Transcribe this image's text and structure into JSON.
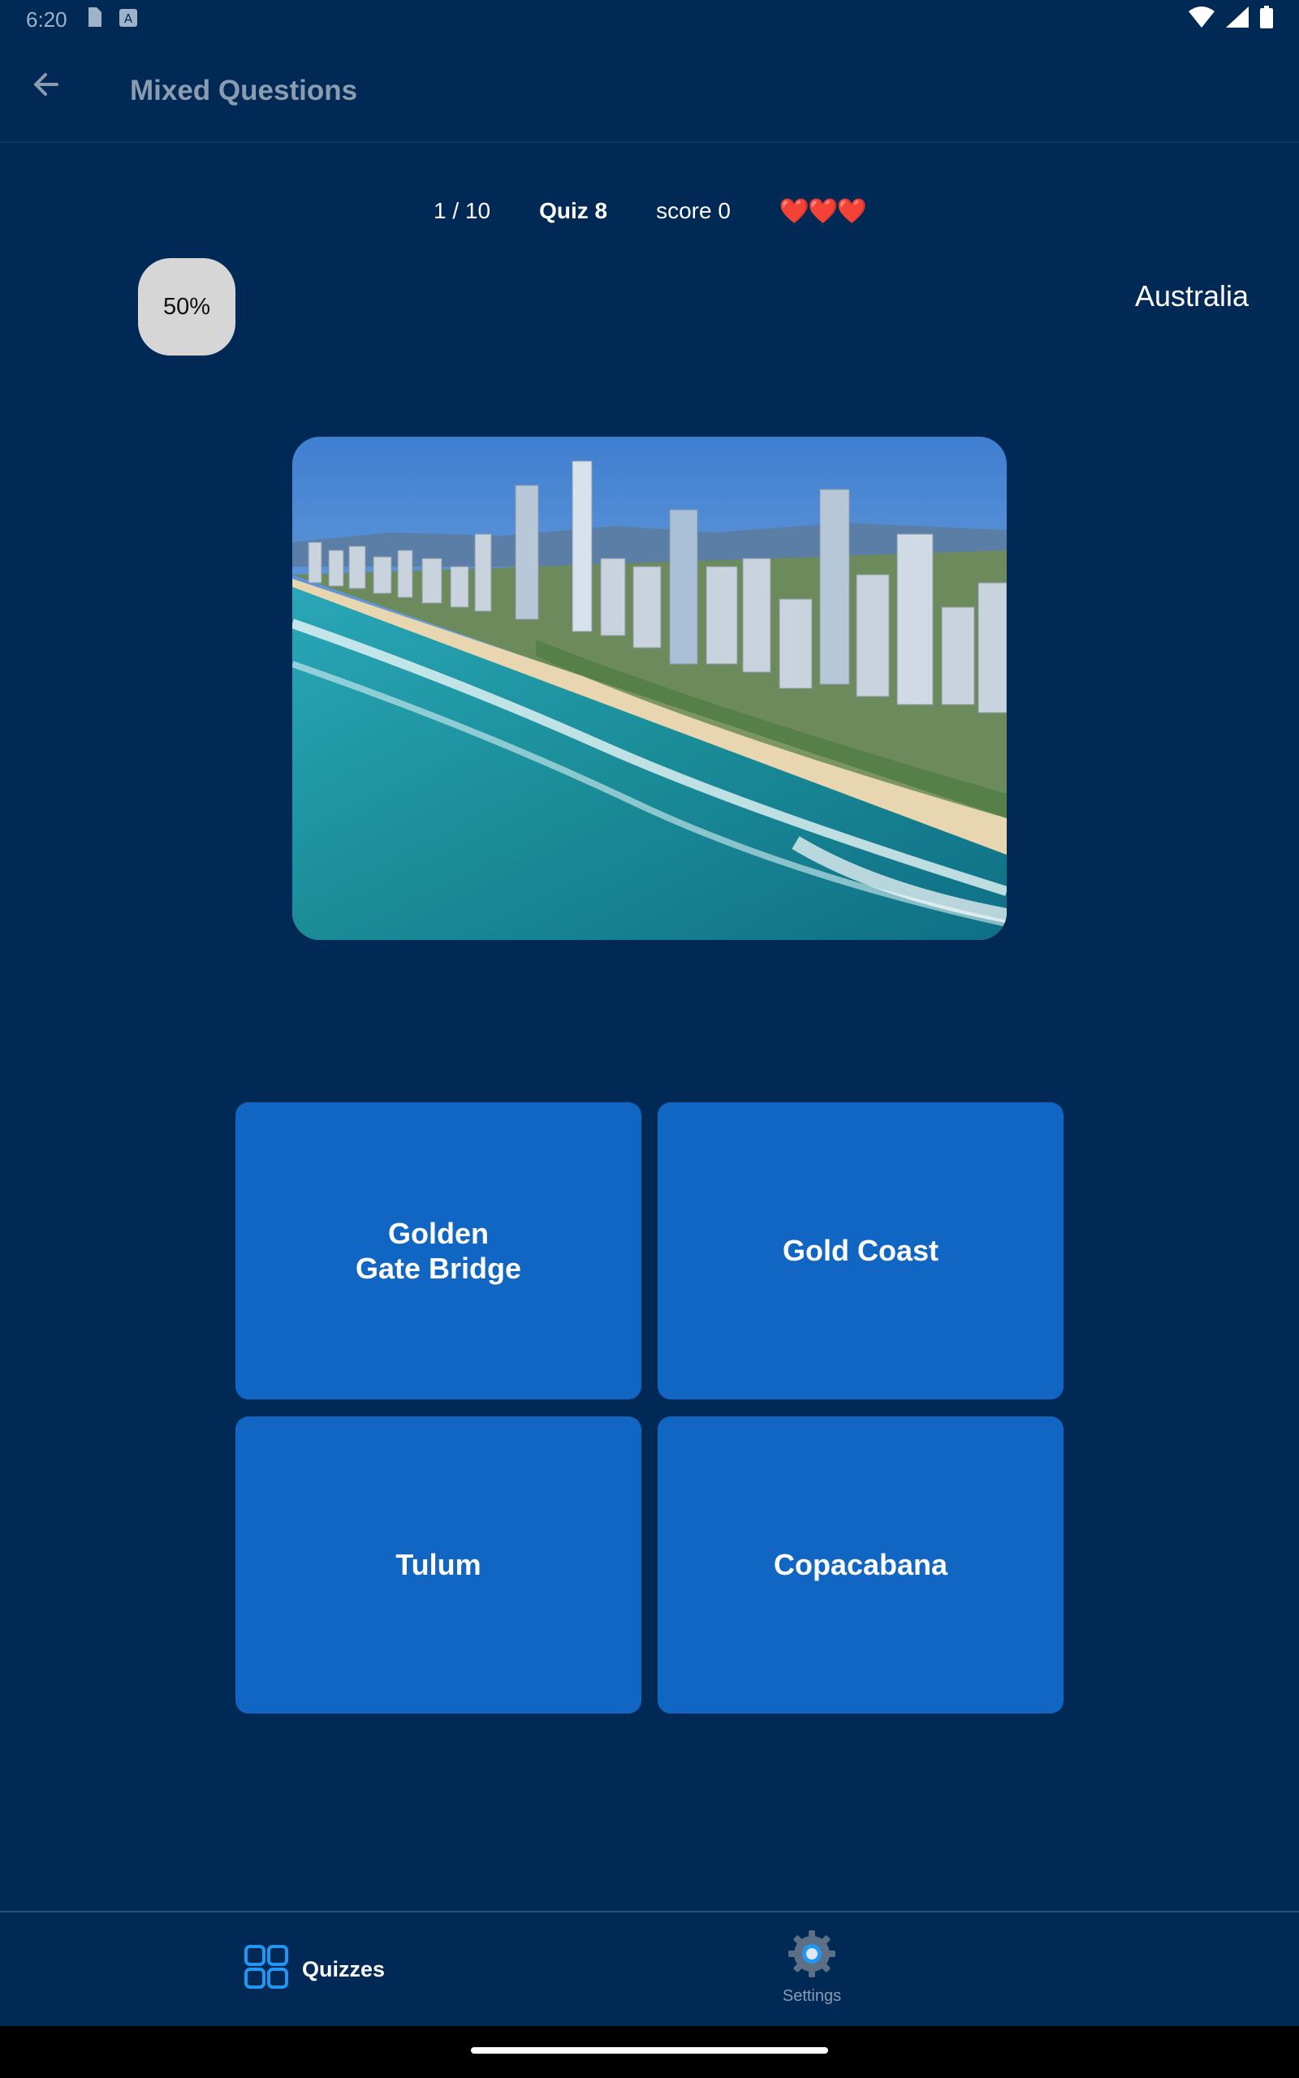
{
  "status_bar": {
    "time": "6:20",
    "icons": [
      "sim-card-icon",
      "a-box-icon",
      "wifi-icon",
      "signal-icon",
      "battery-icon"
    ]
  },
  "app_bar": {
    "back_icon": "arrow-left-icon",
    "title": "Mixed Questions"
  },
  "quiz_info": {
    "progress": "1 / 10",
    "quiz_name": "Quiz 8",
    "score": "score 0",
    "lives": "❤️❤️❤️"
  },
  "lifeline": {
    "label": "50%"
  },
  "category": "Australia",
  "question_image": {
    "subject": "coastal city skyline aerial photo"
  },
  "answers": [
    {
      "label": "Golden\nGate Bridge"
    },
    {
      "label": "Gold Coast"
    },
    {
      "label": "Tulum"
    },
    {
      "label": "Copacabana"
    }
  ],
  "bottom_nav": {
    "quizzes": {
      "label": "Quizzes",
      "icon": "grid-icon"
    },
    "settings": {
      "label": "Settings",
      "icon": "gear-icon"
    }
  },
  "colors": {
    "background": "#002a55",
    "answer_button": "#1066c2",
    "lifeline": "#d6d6d6",
    "accent_icon": "#2196f3"
  }
}
